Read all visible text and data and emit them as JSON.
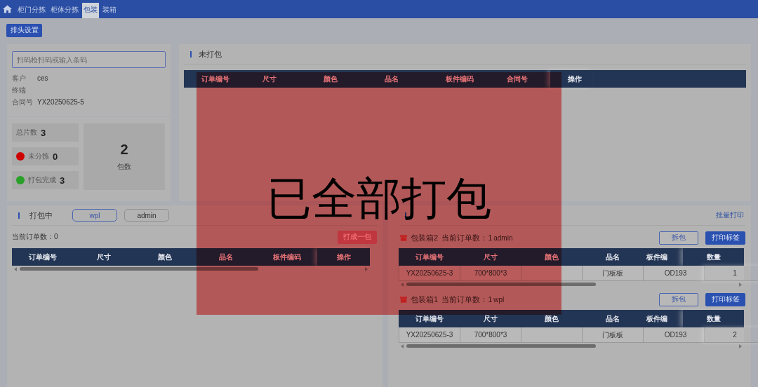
{
  "nav": {
    "items": [
      {
        "label": "柜门分拣",
        "selected": false
      },
      {
        "label": "柜体分拣",
        "selected": false
      },
      {
        "label": "包装",
        "selected": true
      },
      {
        "label": "装箱",
        "selected": false
      }
    ]
  },
  "toolbar": {
    "button": "排头设置"
  },
  "scan": {
    "placeholder": "扫码枪扫码或输入条码",
    "info": [
      {
        "label": "客户",
        "value": "ces"
      },
      {
        "label": "终端"
      },
      {
        "label": "合同号",
        "value": "YX20250625-5"
      }
    ]
  },
  "stats": {
    "items": [
      {
        "label": "总片数",
        "value": "3"
      },
      {
        "label": "未分拣",
        "value": "0",
        "color": "#cc0000"
      },
      {
        "label": "打包完成",
        "value": "3",
        "color": "#2aa02a"
      }
    ],
    "packages": {
      "value": "2",
      "label": "包数"
    }
  },
  "unpacked": {
    "title": "未打包",
    "columns": [
      "订单编号",
      "尺寸",
      "颜色",
      "品名",
      "板件编码",
      "合同号"
    ],
    "fixed_column": "操作"
  },
  "packing": {
    "title": "打包中",
    "users": [
      {
        "label": "wpl",
        "selected": true
      },
      {
        "label": "admin",
        "selected": false
      }
    ],
    "count": "当前订单数：0",
    "button": "打成一包",
    "columns": [
      "订单编号",
      "尺寸",
      "颜色",
      "品名",
      "板件编码"
    ],
    "fixed_column": "操作"
  },
  "packed": {
    "link": "批量打印",
    "boxes": [
      {
        "name": "包装箱2",
        "count": "当前订单数：1",
        "user": "admin",
        "buttons": [
          "拆包",
          "打印标签"
        ],
        "columns": [
          "订单编号",
          "尺寸",
          "颜色",
          "品名",
          "板件编"
        ],
        "fixed_column": "数量",
        "rows": [
          {
            "cells": [
              "YX20250625-3",
              "700*800*3",
              "",
              "门板板",
              "OD193"
            ],
            "fixed": "1"
          }
        ]
      },
      {
        "name": "包装箱1",
        "count": "当前订单数：1",
        "user": "wpl",
        "buttons": [
          "拆包",
          "打印标签"
        ],
        "columns": [
          "订单编号",
          "尺寸",
          "颜色",
          "品名",
          "板件编"
        ],
        "fixed_column": "数量",
        "rows": [
          {
            "cells": [
              "YX20250625-3",
              "700*800*3",
              "",
              "门板板",
              "OD193"
            ],
            "fixed": "2"
          }
        ]
      }
    ]
  },
  "dialog": {
    "message": "已全部打包"
  }
}
